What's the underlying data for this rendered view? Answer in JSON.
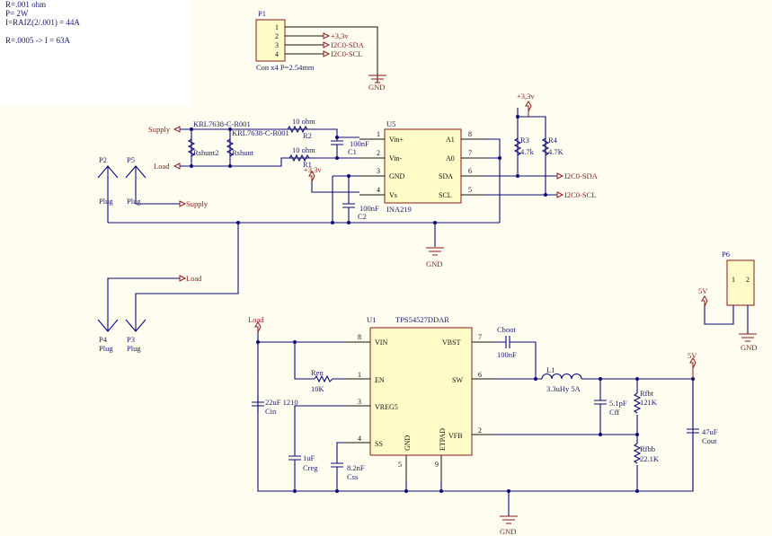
{
  "notes": {
    "line1": "R=.001 ohm",
    "line2": "P= 2W",
    "line3": "I=RAIZ(2/.001) = 44A",
    "line4": "R=.0005 -> I = 63A"
  },
  "p1": {
    "designator": "P1",
    "pins": [
      "1",
      "2",
      "3",
      "4"
    ],
    "desc": "Con x4 P=2.54mm",
    "nets": [
      "+3,3v",
      "I2C0-SDA",
      "I2C0-SCL"
    ],
    "gnd": "GND"
  },
  "shunt": {
    "supply": "Supply",
    "load": "Load",
    "part1": "KRL7638-C-R001",
    "part2": "KRL7638-C-R001",
    "rshunt2": "Rshunt2",
    "rshunt": "Rshunt",
    "r2_value": "10 ohm",
    "r2": "R2",
    "r1_value": "10 ohm",
    "r1": "R1",
    "c1_value": "100nF",
    "c1": "C1",
    "c2_value": "100nF",
    "c2": "C2",
    "vcc": "+3,3v"
  },
  "u5": {
    "designator": "U5",
    "part": "INA219",
    "left_pins": [
      {
        "name": "Vin+",
        "num": "1"
      },
      {
        "name": "Vin-",
        "num": "2"
      },
      {
        "name": "GND",
        "num": "3"
      },
      {
        "name": "Vs",
        "num": "4"
      }
    ],
    "right_pins": [
      {
        "name": "A1",
        "num": "8"
      },
      {
        "name": "A0",
        "num": "7"
      },
      {
        "name": "SDA",
        "num": "6"
      },
      {
        "name": "SCL",
        "num": "5"
      }
    ]
  },
  "pullups": {
    "vcc": "+3,3v",
    "r3": "R3",
    "r3_value": "4.7k",
    "r4": "R4",
    "r4_value": "4.7K",
    "sda": "I2C0-SDA",
    "scl": "I2C0-SCL",
    "gnd": "GND"
  },
  "plugs": {
    "p2": "P2",
    "p5": "P5",
    "p4": "P4",
    "p3": "P3",
    "plug": "Plug",
    "supply": "Supply",
    "load": "Load"
  },
  "p6": {
    "designator": "P6",
    "pin1": "1",
    "pin2": "2",
    "net": "5V",
    "gnd": "GND"
  },
  "u1": {
    "designator": "U1",
    "part": "TPS54527DDAR",
    "load": "Load",
    "left_pins": [
      {
        "name": "VIN",
        "num": "8"
      },
      {
        "name": "EN",
        "num": "1"
      },
      {
        "name": "VREG5",
        "num": "3"
      },
      {
        "name": "SS",
        "num": "4"
      }
    ],
    "right_pins": [
      {
        "name": "VBST",
        "num": "7"
      },
      {
        "name": "SW",
        "num": "6"
      },
      {
        "name": "VFB",
        "num": "2"
      }
    ],
    "bottom_pins": [
      {
        "name": "GND",
        "num": "5"
      },
      {
        "name": "ETPAD",
        "num": "9"
      }
    ]
  },
  "buck": {
    "ren": "Ren",
    "ren_value": "10K",
    "cin_value": "22uF 1210",
    "cin": "Cin",
    "creg_value": "1uF",
    "creg": "Creg",
    "css_value": "8.2nF",
    "css": "Css",
    "cboot": "Cboot",
    "cboot_value": "100nF",
    "l1": "L1",
    "l1_value": "3.3uHy 5A",
    "cff_value": "5.1pF",
    "cff": "Cff",
    "rfbt": "Rfbt",
    "rfbt_value": "121K",
    "rfbb": "Rfbb",
    "rfbb_value": "22.1K",
    "cout_value": "47uF",
    "cout": "Cout",
    "vout": "5V",
    "gnd": "GND"
  }
}
